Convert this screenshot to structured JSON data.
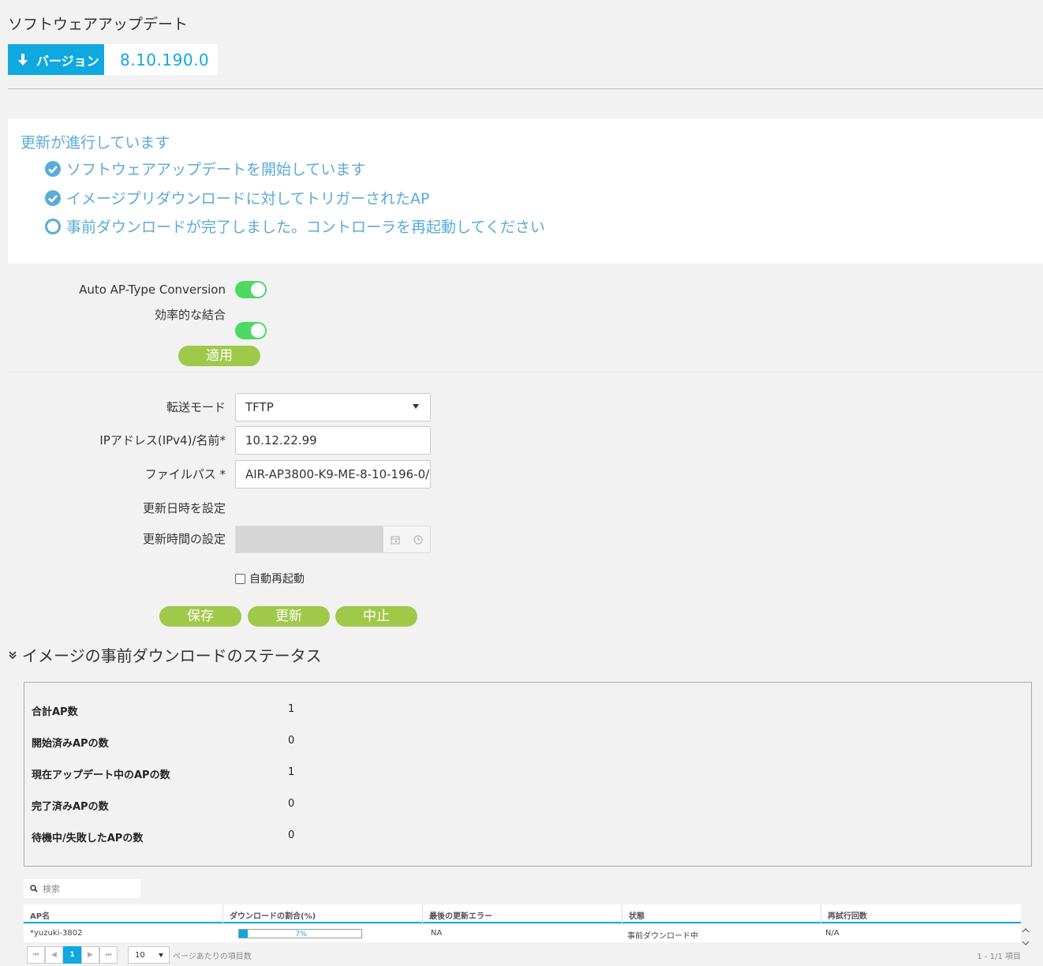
{
  "page": {
    "title": "ソフトウェアアップデート",
    "version_label": "バージョン",
    "version_value": "8.10.190.0"
  },
  "progress": {
    "title": "更新が進行しています",
    "steps": [
      {
        "label": "ソフトウェアアップデートを開始しています",
        "done": true
      },
      {
        "label": "イメージプリダウンロードに対してトリガーされたAP",
        "done": true
      },
      {
        "label": "事前ダウンロードが完了しました。コントローラを再起動してください",
        "done": false
      }
    ]
  },
  "settings": {
    "auto_ap_label": "Auto AP-Type Conversion",
    "auto_ap_on": true,
    "efficient_join_label": "効率的な結合",
    "efficient_join_on": true,
    "apply_label": "適用"
  },
  "form": {
    "transfer_mode_label": "転送モード",
    "transfer_mode_value": "TFTP",
    "ip_label": "IPアドレス(IPv4)/名前*",
    "ip_value": "10.12.22.99",
    "filepath_label": "ファイルパス *",
    "filepath_value": "AIR-AP3800-K9-ME-8-10-196-0/",
    "set_datetime_label": "更新日時を設定",
    "set_datetime_on": false,
    "update_time_label": "更新時間の設定",
    "auto_reboot_label": "自動再起動",
    "auto_reboot_checked": false,
    "save_label": "保存",
    "update_label": "更新",
    "abort_label": "中止"
  },
  "status": {
    "section_title": "イメージの事前ダウンロードのステータス",
    "rows": [
      {
        "label": "合計AP数",
        "value": "1"
      },
      {
        "label": "開始済みAPの数",
        "value": "0"
      },
      {
        "label": "現在アップデート中のAPの数",
        "value": "1"
      },
      {
        "label": "完了済みAPの数",
        "value": "0"
      },
      {
        "label": "待機中/失敗したAPの数",
        "value": "0"
      }
    ]
  },
  "table": {
    "search_placeholder": "検索",
    "columns": [
      "AP名",
      "ダウンロードの割合(%)",
      "最後の更新エラー",
      "状態",
      "再試行回数"
    ],
    "rows": [
      {
        "ap_name": "*yuzuki-3802",
        "percent": 7,
        "percent_text": "7%",
        "last_error": "NA",
        "state": "事前ダウンロード中",
        "retries": "N/A"
      }
    ],
    "pager": {
      "current_page": "1",
      "page_size": "10",
      "page_size_label": "ページあたりの項目数",
      "summary": "1 - 1/1 項目"
    }
  },
  "colors": {
    "accent": "#0fa9e0",
    "progress_text": "#5aabd8",
    "green_button": "#a0c94a",
    "toggle_on": "#4cd964"
  }
}
